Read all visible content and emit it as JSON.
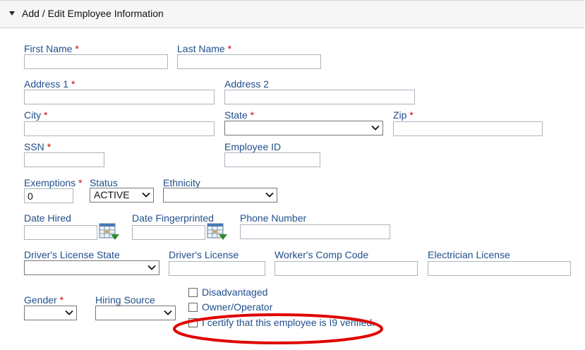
{
  "section": {
    "title": "Add / Edit Employee Information"
  },
  "labels": {
    "first_name": "First Name",
    "last_name": "Last Name",
    "address1": "Address 1",
    "address2": "Address 2",
    "city": "City",
    "state": "State",
    "zip": "Zip",
    "ssn": "SSN",
    "employee_id": "Employee ID",
    "exemptions": "Exemptions",
    "status": "Status",
    "ethnicity": "Ethnicity",
    "date_hired": "Date Hired",
    "date_fingerprinted": "Date Fingerprinted",
    "phone_number": "Phone Number",
    "dl_state": "Driver's License State",
    "drivers_license": "Driver's License",
    "workers_comp": "Worker's Comp Code",
    "electrician_license": "Electrician License",
    "gender": "Gender",
    "hiring_source": "Hiring Source"
  },
  "required_marker": "*",
  "fields": {
    "first_name": "",
    "last_name": "",
    "address1": "",
    "address2": "",
    "city": "",
    "state": "",
    "zip": "",
    "ssn": "",
    "employee_id": "",
    "exemptions": "0",
    "status": "ACTIVE",
    "ethnicity": "",
    "date_hired": "",
    "date_fingerprinted": "",
    "phone_number": "",
    "dl_state": "",
    "drivers_license": "",
    "workers_comp": "",
    "electrician_license": "",
    "gender": "",
    "hiring_source": ""
  },
  "checkboxes": {
    "disadvantaged": {
      "label": "Disadvantaged",
      "checked": false
    },
    "owner_operator": {
      "label": "Owner/Operator",
      "checked": false
    },
    "i9_verified": {
      "label": "I certify that this employee is I9 verified.",
      "checked": false
    }
  },
  "annotation": {
    "color": "#e00000",
    "shape": "ellipse-highlight"
  },
  "colors": {
    "label": "#1f4f8c",
    "required": "#d40000",
    "header_bg": "#f6f6f6"
  }
}
